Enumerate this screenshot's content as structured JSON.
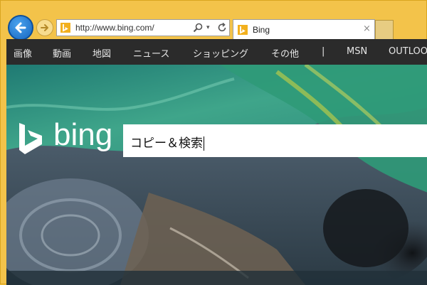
{
  "browser": {
    "address": "http://www.bing.com/",
    "tab_title": "Bing",
    "tab_close": "×",
    "dropdown_glyph": "▾"
  },
  "navbar": {
    "items": [
      "画像",
      "動画",
      "地図",
      "ニュース",
      "ショッピング",
      "その他",
      "|",
      "MSN",
      "OUTLOOK"
    ]
  },
  "logo": {
    "text": "bing"
  },
  "search": {
    "value": "コピー＆検索"
  },
  "colors": {
    "window_frame": "#f3c34a",
    "navbar_bg": "#2b2b2b",
    "back_button": "#1565c0",
    "bing_favicon": "#f2b01e"
  },
  "icons": [
    "back-arrow-icon",
    "forward-arrow-icon",
    "bing-favicon-icon",
    "search-icon",
    "refresh-icon",
    "close-icon",
    "bing-logo-icon"
  ]
}
